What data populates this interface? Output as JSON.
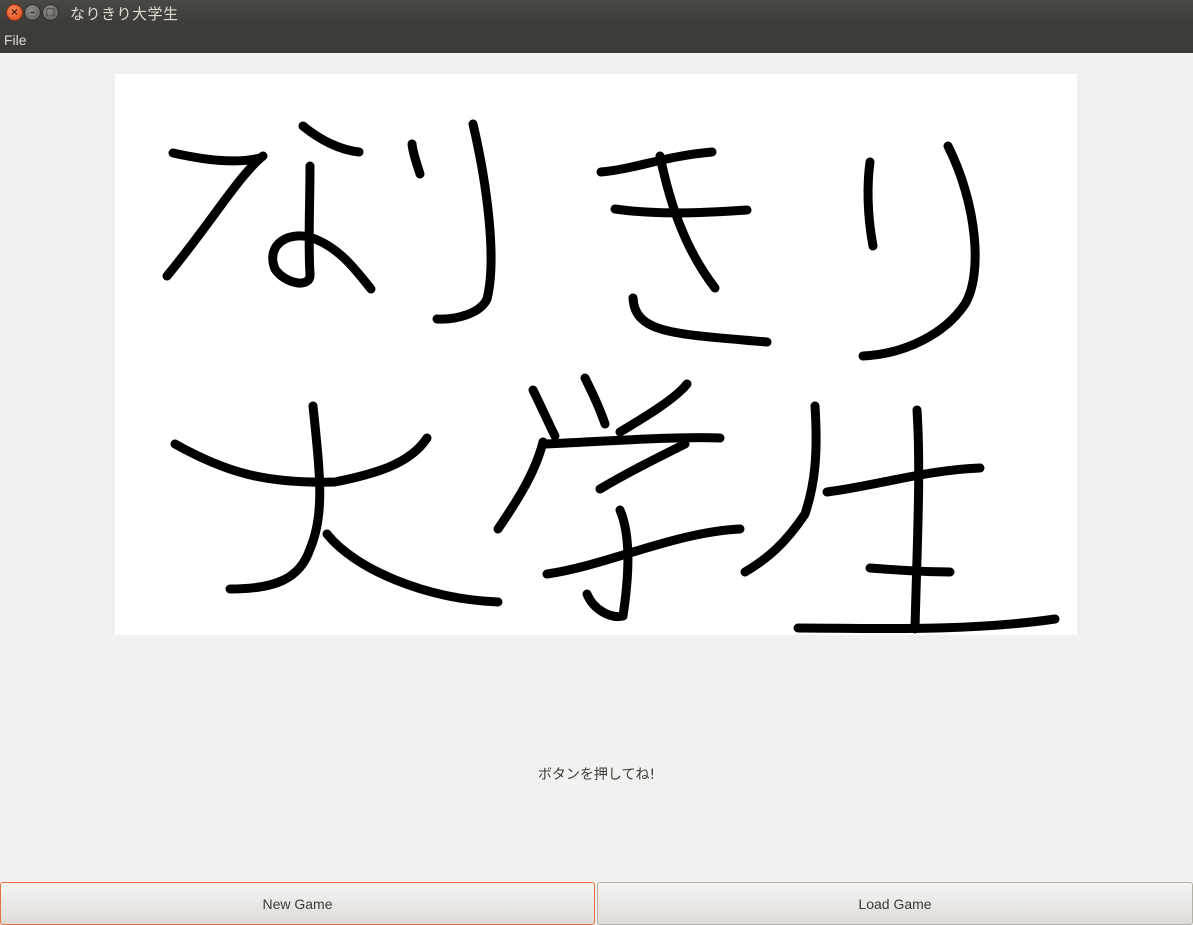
{
  "window": {
    "title": "なりきり大学生",
    "close_glyph": "×",
    "minimize_glyph": "–",
    "maximize_glyph": "□"
  },
  "menubar": {
    "items": [
      {
        "label": "File"
      }
    ]
  },
  "main": {
    "image_text": "なりきり大学生",
    "message": "ボタンを押してね!"
  },
  "buttons": {
    "new_game": "New Game",
    "load_game": "Load Game"
  },
  "colors": {
    "titlebar": "#3c3b37",
    "background": "#f2f1f0",
    "focus_accent": "#e4713f"
  }
}
